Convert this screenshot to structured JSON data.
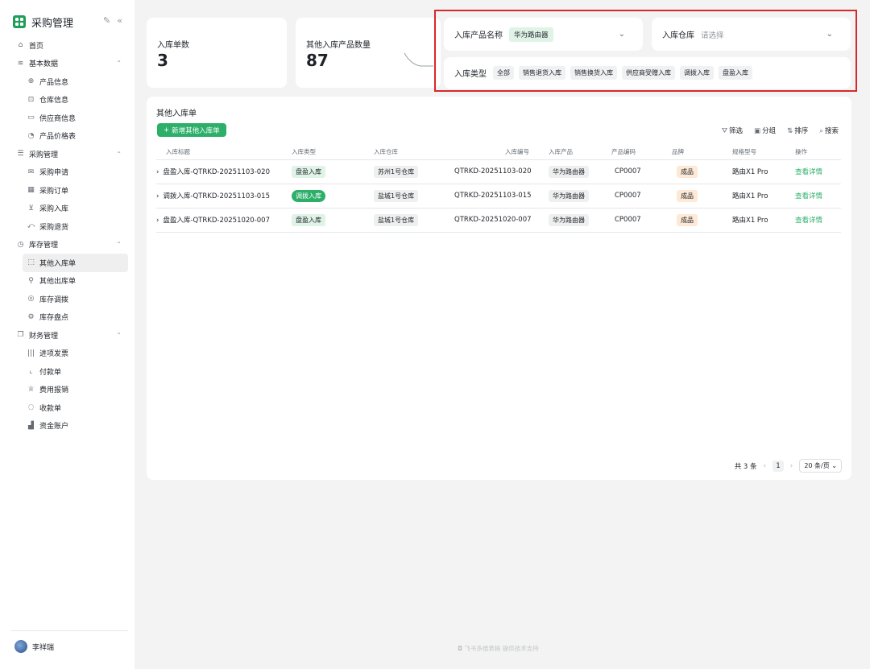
{
  "app": {
    "title": "采购管理"
  },
  "sidebar": {
    "items": [
      {
        "label": "首页",
        "icon": "home-icon",
        "level": 0
      },
      {
        "label": "基本数据",
        "icon": "layers-icon",
        "level": 0,
        "expanded": true
      },
      {
        "label": "产品信息",
        "icon": "globe-icon",
        "level": 1
      },
      {
        "label": "仓库信息",
        "icon": "warehouse-icon",
        "level": 1
      },
      {
        "label": "供应商信息",
        "icon": "monitor-icon",
        "level": 1
      },
      {
        "label": "产品价格表",
        "icon": "price-icon",
        "level": 1
      },
      {
        "label": "采购管理",
        "icon": "list-icon",
        "level": 0,
        "expanded": true
      },
      {
        "label": "采购申请",
        "icon": "mail-icon",
        "level": 1
      },
      {
        "label": "采购订单",
        "icon": "calendar-icon",
        "level": 1
      },
      {
        "label": "采购入库",
        "icon": "inbox-icon",
        "level": 1
      },
      {
        "label": "采购退货",
        "icon": "return-icon",
        "level": 1
      },
      {
        "label": "库存管理",
        "icon": "clock-icon",
        "level": 0,
        "expanded": true
      },
      {
        "label": "其他入库单",
        "icon": "stock-in-icon",
        "level": 1,
        "active": true
      },
      {
        "label": "其他出库单",
        "icon": "stock-out-icon",
        "level": 1
      },
      {
        "label": "库存调拨",
        "icon": "transfer-icon",
        "level": 1
      },
      {
        "label": "库存盘点",
        "icon": "gear-icon",
        "level": 1
      },
      {
        "label": "财务管理",
        "icon": "copy-icon",
        "level": 0,
        "expanded": true
      },
      {
        "label": "进项发票",
        "icon": "barcode-icon",
        "level": 1
      },
      {
        "label": "付款单",
        "icon": "chart-line-icon",
        "level": 1
      },
      {
        "label": "费用报销",
        "icon": "trophy-icon",
        "level": 1
      },
      {
        "label": "收款单",
        "icon": "bulb-icon",
        "level": 1
      },
      {
        "label": "资金账户",
        "icon": "bar-chart-icon",
        "level": 1
      }
    ]
  },
  "user": {
    "name": "李祥瑞"
  },
  "stats": [
    {
      "label": "入库单数",
      "value": "3"
    },
    {
      "label": "其他入库产品数量",
      "value": "87"
    }
  ],
  "filters": {
    "product_label": "入库产品名称",
    "product_value": "华为路由器",
    "warehouse_label": "入库仓库",
    "warehouse_placeholder": "请选择",
    "type_label": "入库类型",
    "type_options": [
      "全部",
      "销售退货入库",
      "销售换货入库",
      "供应商受赠入库",
      "调拨入库",
      "盘盈入库"
    ]
  },
  "table": {
    "title": "其他入库单",
    "add_button": "新增其他入库单",
    "toolbar": {
      "filter": "筛选",
      "group": "分组",
      "sort": "排序",
      "search": "搜索"
    },
    "columns": [
      "入库标题",
      "入库类型",
      "入库仓库",
      "入库编号",
      "入库产品",
      "产品编码",
      "品牌",
      "规格型号",
      "操作"
    ],
    "rows": [
      {
        "title": "盘盈入库-QTRKD-20251103-020",
        "type": "盘盈入库",
        "warehouse": "苏州1号仓库",
        "code": "QTRKD-20251103-020",
        "product": "华为路由器",
        "product_code": "CP0007",
        "brand": "成品",
        "spec": "路由X1 Pro",
        "action": "查看详情"
      },
      {
        "title": "调拨入库-QTRKD-20251103-015",
        "type": "调拨入库",
        "warehouse": "盐城1号仓库",
        "code": "QTRKD-20251103-015",
        "product": "华为路由器",
        "product_code": "CP0007",
        "brand": "成品",
        "spec": "路由X1 Pro",
        "action": "查看详情"
      },
      {
        "title": "盘盈入库-QTRKD-20251020-007",
        "type": "盘盈入库",
        "warehouse": "盐城1号仓库",
        "code": "QTRKD-20251020-007",
        "product": "华为路由器",
        "product_code": "CP0007",
        "brand": "成品",
        "spec": "路由X1 Pro",
        "action": "查看详情"
      }
    ]
  },
  "pagination": {
    "total": "共 3 条",
    "current": "1",
    "page_size": "20 条/页"
  },
  "footer": {
    "text": "飞书多维表格 提供技术支持"
  },
  "colors": {
    "accent": "#2daf6a",
    "highlight_border": "#d9282a"
  }
}
